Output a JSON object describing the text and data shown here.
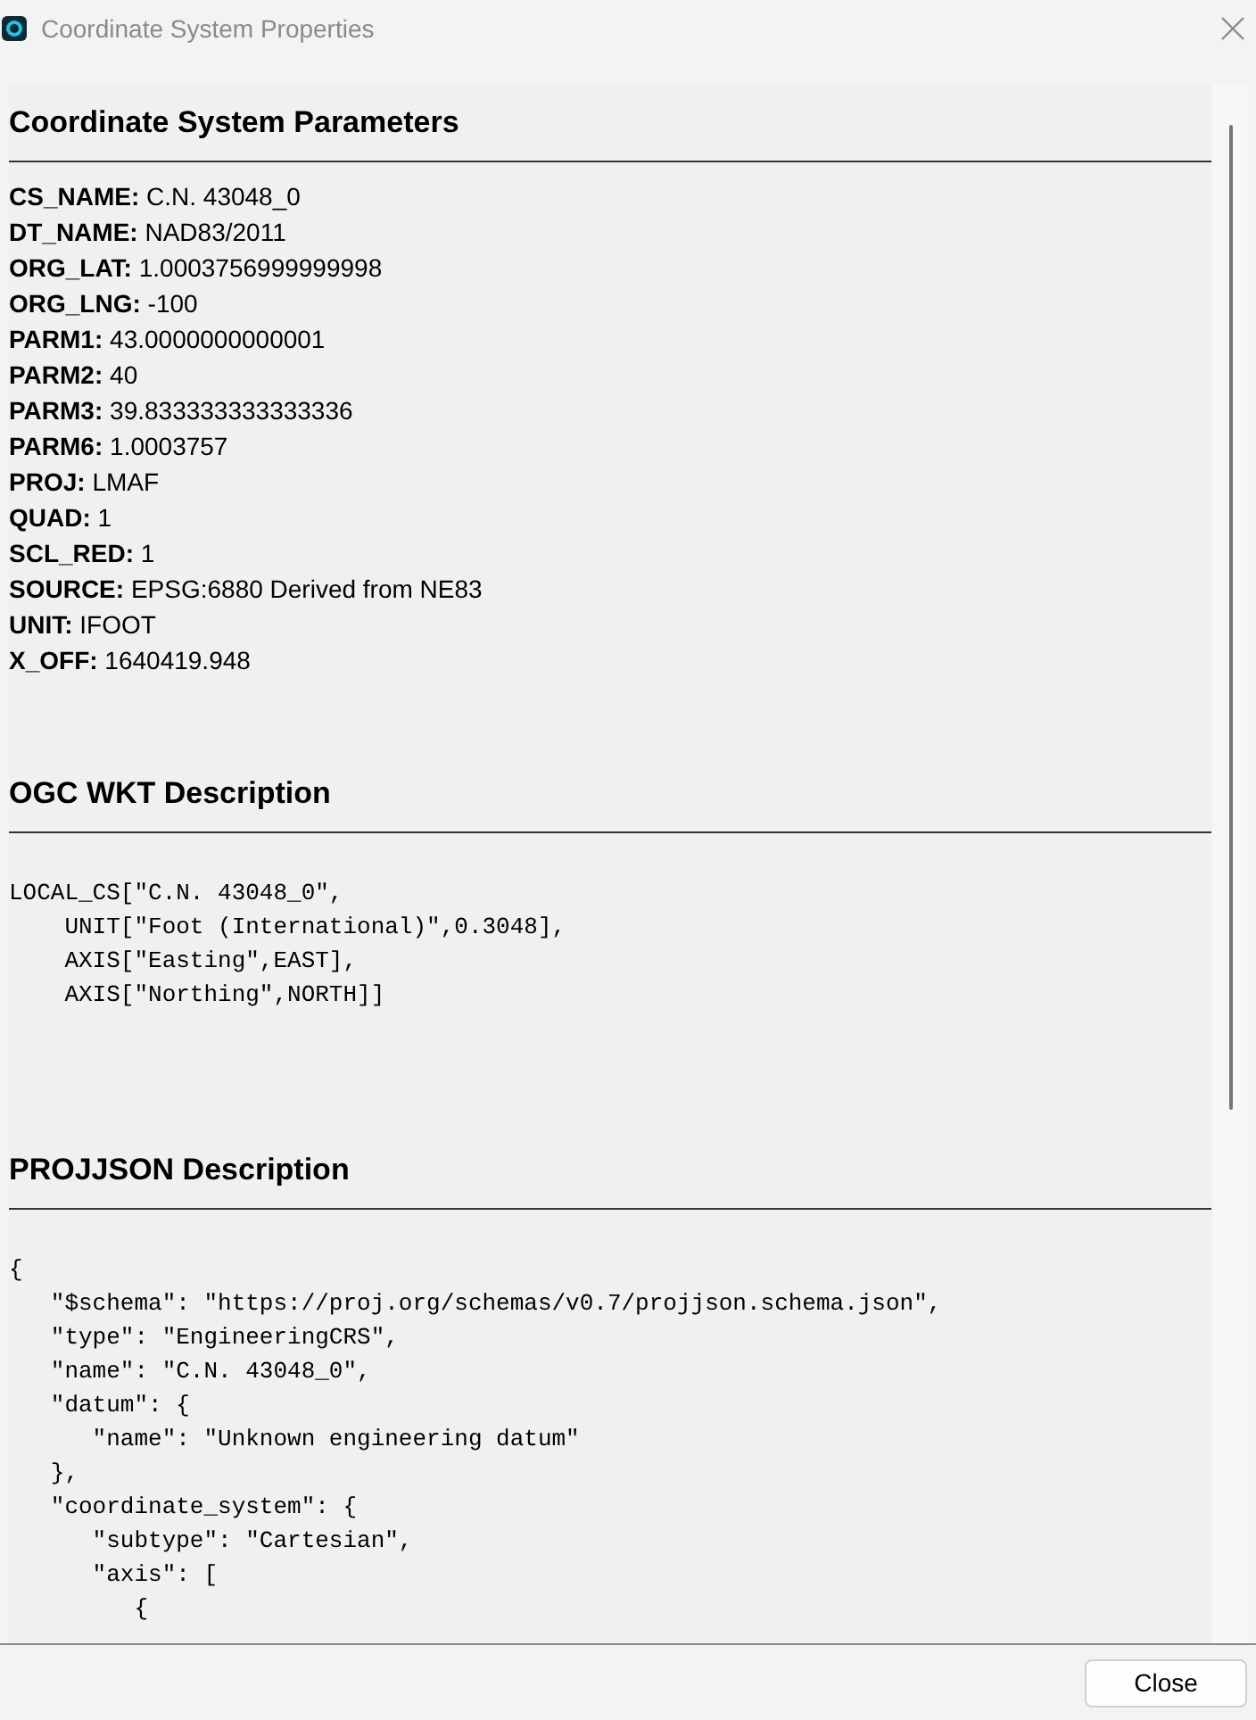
{
  "window": {
    "title": "Coordinate System Properties"
  },
  "sections": [
    {
      "kind": "fields",
      "heading": "Coordinate System Parameters",
      "fields": [
        {
          "key": "CS_NAME:",
          "value": "C.N. 43048_0"
        },
        {
          "key": "DT_NAME:",
          "value": "NAD83/2011"
        },
        {
          "key": "ORG_LAT:",
          "value": "1.0003756999999998"
        },
        {
          "key": "ORG_LNG:",
          "value": "-100"
        },
        {
          "key": "PARM1:",
          "value": "43.0000000000001"
        },
        {
          "key": "PARM2:",
          "value": "40"
        },
        {
          "key": "PARM3:",
          "value": "39.833333333333336"
        },
        {
          "key": "PARM6:",
          "value": "1.0003757"
        },
        {
          "key": "PROJ:",
          "value": "LMAF"
        },
        {
          "key": "QUAD:",
          "value": "1"
        },
        {
          "key": "SCL_RED:",
          "value": "1"
        },
        {
          "key": "SOURCE:",
          "value": "EPSG:6880 Derived from NE83"
        },
        {
          "key": "UNIT:",
          "value": "IFOOT"
        },
        {
          "key": "X_OFF:",
          "value": "1640419.948"
        }
      ]
    },
    {
      "kind": "code",
      "heading": "OGC WKT Description",
      "lines": [
        "LOCAL_CS[\"C.N. 43048_0\",",
        "    UNIT[\"Foot (International)\",0.3048],",
        "    AXIS[\"Easting\",EAST],",
        "    AXIS[\"Northing\",NORTH]]"
      ]
    },
    {
      "kind": "code",
      "heading": "PROJJSON Description",
      "lines": [
        "{",
        "   \"$schema\": \"https://proj.org/schemas/v0.7/projjson.schema.json\",",
        "   \"type\": \"EngineeringCRS\",",
        "   \"name\": \"C.N. 43048_0\",",
        "   \"datum\": {",
        "      \"name\": \"Unknown engineering datum\"",
        "   },",
        "   \"coordinate_system\": {",
        "      \"subtype\": \"Cartesian\",",
        "      \"axis\": [",
        "         {"
      ]
    }
  ],
  "buttons": [
    "Close"
  ]
}
